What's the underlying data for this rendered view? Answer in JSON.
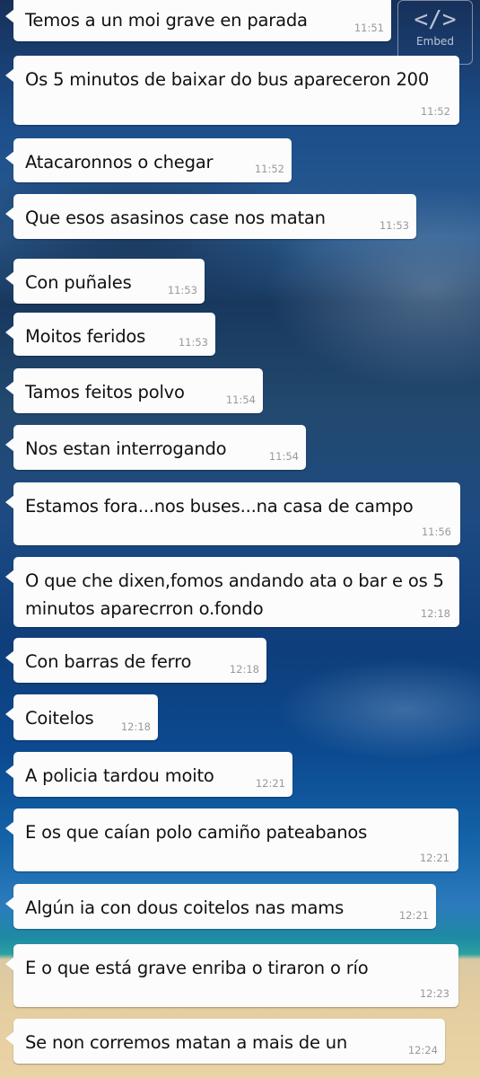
{
  "overlay": {
    "embed_icon": "</>",
    "embed_label": "Embed"
  },
  "messages": [
    {
      "text": "Temos a un moi grave en parada",
      "time": "11:51"
    },
    {
      "text": "Os 5 minutos de baixar do bus apareceron 200",
      "time": "11:52"
    },
    {
      "text": "Atacaronnos o chegar",
      "time": "11:52"
    },
    {
      "text": "Que esos asasinos case nos matan",
      "time": "11:53"
    },
    {
      "text": "Con puñales",
      "time": "11:53"
    },
    {
      "text": "Moitos feridos",
      "time": "11:53"
    },
    {
      "text": "Tamos feitos polvo",
      "time": "11:54"
    },
    {
      "text": "Nos estan interrogando",
      "time": "11:54"
    },
    {
      "text": "Estamos fora...nos buses...na casa de campo",
      "time": "11:56"
    },
    {
      "text": "O que che dixen,fomos andando ata o bar e os 5 minutos aparecrron o.fondo",
      "time": "12:18"
    },
    {
      "text": "Con barras de ferro",
      "time": "12:18"
    },
    {
      "text": "Coitelos",
      "time": "12:18"
    },
    {
      "text": "A policia tardou moito",
      "time": "12:21"
    },
    {
      "text": "E os que caían polo camiño pateabanos",
      "time": "12:21"
    },
    {
      "text": "Algún ia con dous coitelos nas mams",
      "time": "12:21"
    },
    {
      "text": "E o que está grave enriba o tiraron o río",
      "time": "12:23"
    },
    {
      "text": "Se non corremos matan a mais de un",
      "time": "12:24"
    }
  ]
}
